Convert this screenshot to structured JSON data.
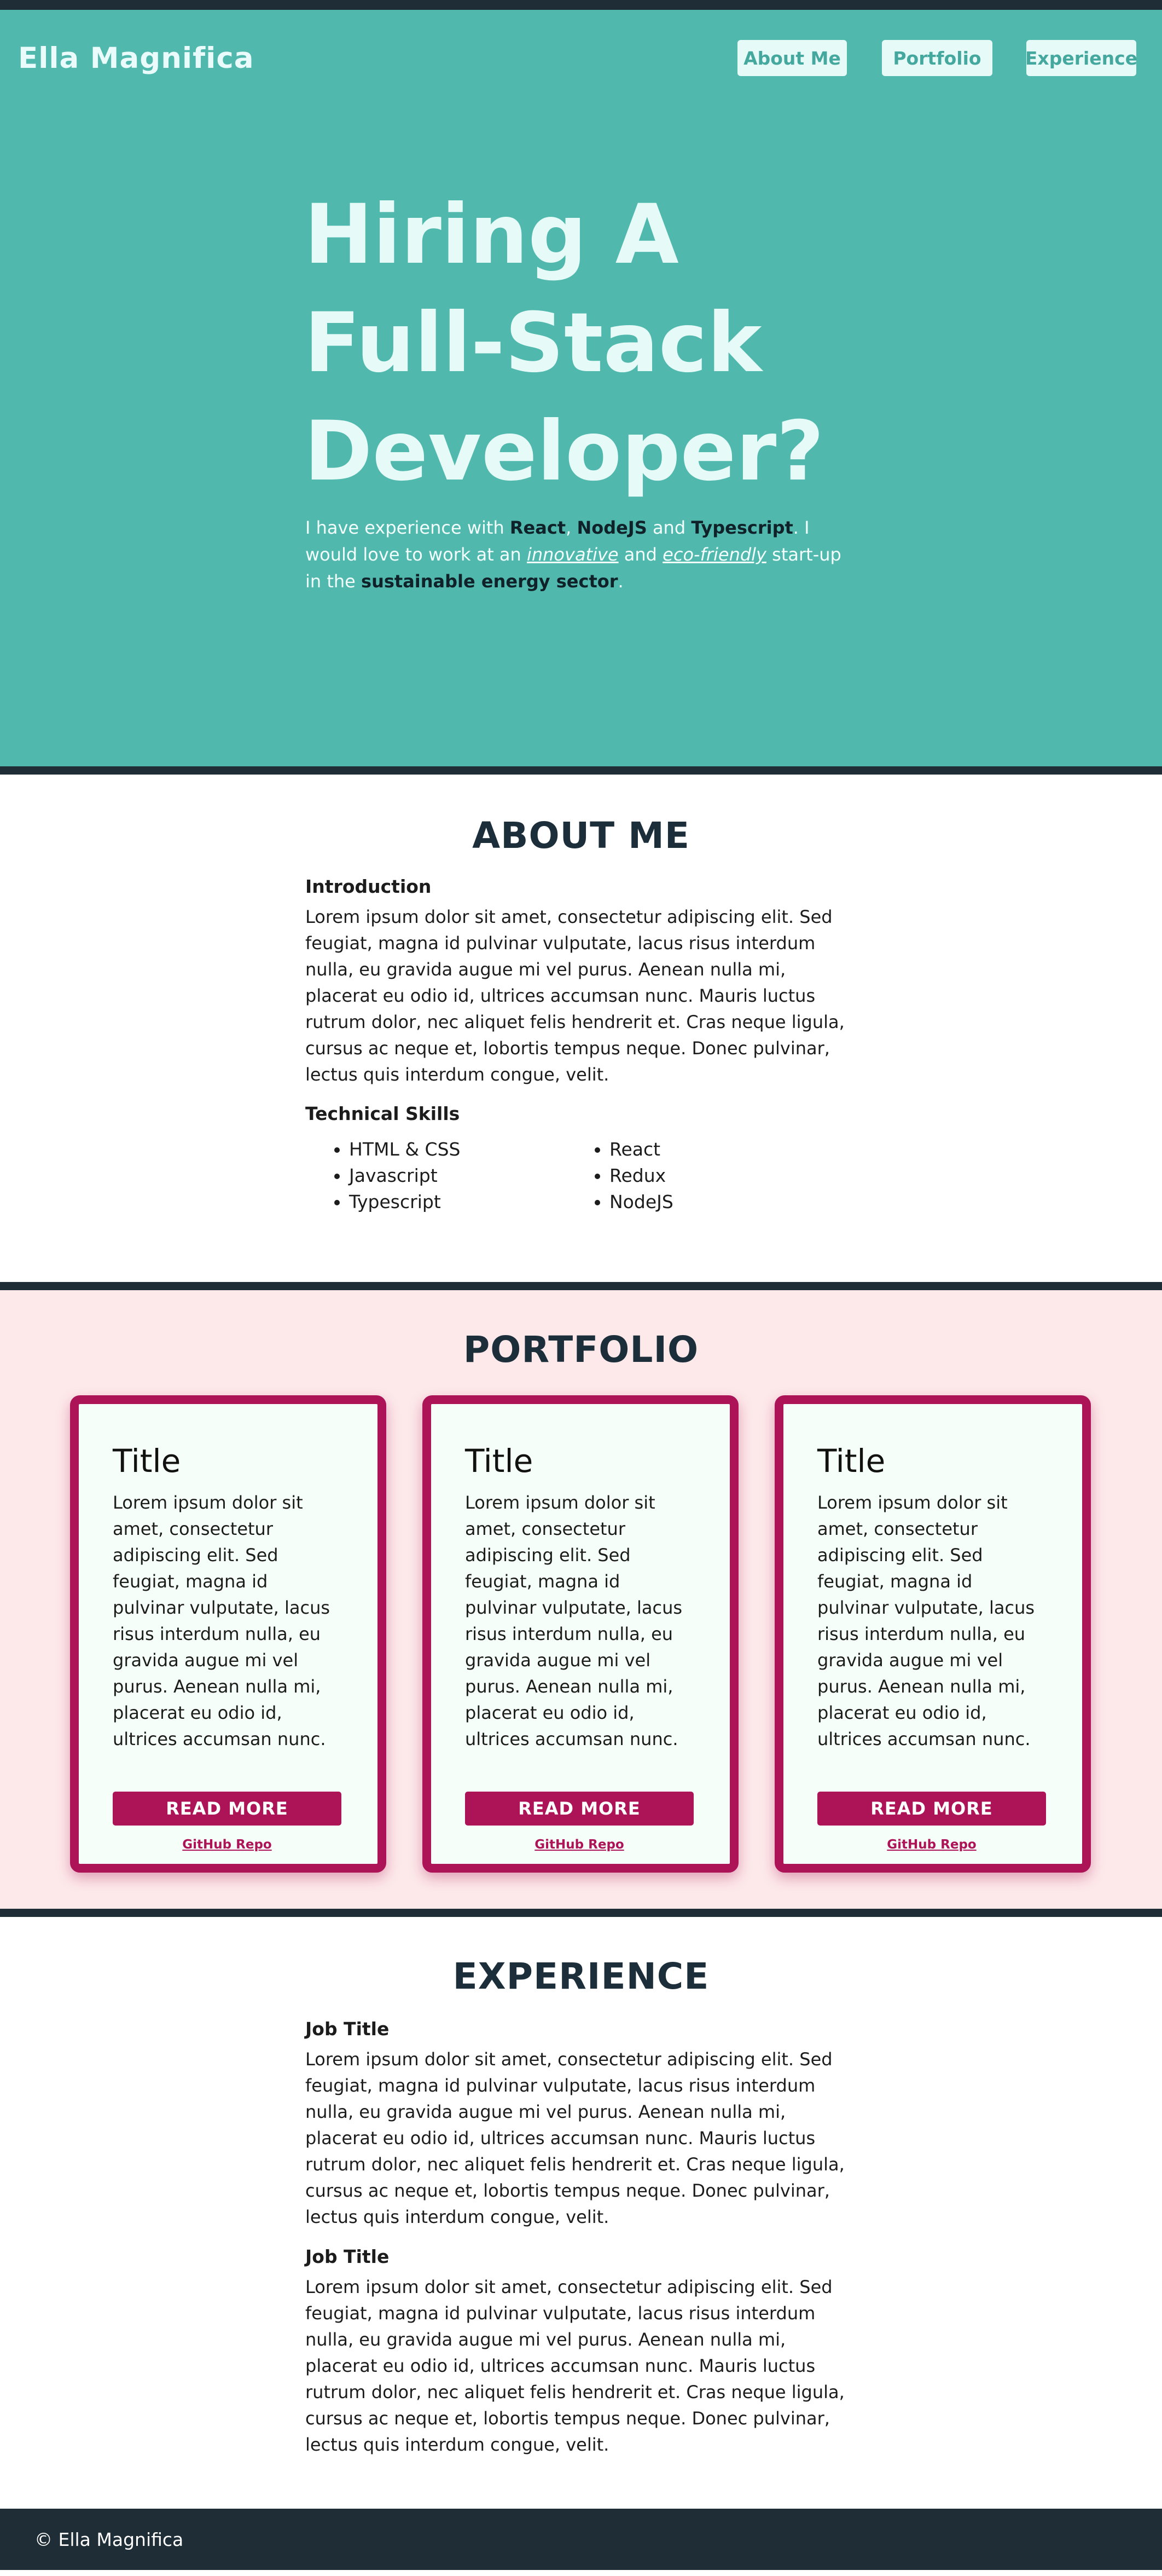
{
  "header": {
    "brand": "Ella Magnifica",
    "nav": [
      "About Me",
      "Portfolio",
      "Experience"
    ]
  },
  "hero": {
    "title_lines": [
      "Hiring A",
      "Full-Stack",
      "Developer?"
    ],
    "text": {
      "t1": "I have experience with ",
      "react": "React",
      "sep1": ", ",
      "node": "NodeJS",
      "sep2": " and ",
      "ts": "Typescript",
      "t2": ". I would love to work at an ",
      "innovative": "innovative",
      "t3": " and ",
      "eco": "eco-friendly",
      "t4": " start-up in the ",
      "sector": "sustainable energy sector",
      "t5": "."
    }
  },
  "about": {
    "title": "ABOUT ME",
    "intro_heading": "Introduction",
    "intro_text": "Lorem ipsum dolor sit amet, consectetur adipiscing elit. Sed feugiat, magna id pulvinar vulputate, lacus risus interdum nulla, eu gravida augue mi vel purus. Aenean nulla mi, placerat eu odio id, ultrices accumsan nunc. Mauris luctus rutrum dolor, nec aliquet felis hendrerit et. Cras neque ligula, cursus ac neque et, lobortis tempus neque. Donec pulvinar, lectus quis interdum congue, velit.",
    "skills_heading": "Technical Skills",
    "skills": [
      "HTML & CSS",
      "React",
      "Javascript",
      "Redux",
      "Typescript",
      "NodeJS"
    ]
  },
  "portfolio": {
    "title": "PORTFOLIO",
    "cards": [
      {
        "title": "Title",
        "text": "Lorem ipsum dolor sit amet, consectetur adipiscing elit. Sed feugiat, magna id pulvinar vulputate, lacus risus interdum nulla, eu gravida augue mi vel purus. Aenean nulla mi, placerat eu odio id, ultrices accumsan nunc.",
        "button": "READ MORE",
        "link": "GitHub Repo"
      },
      {
        "title": "Title",
        "text": "Lorem ipsum dolor sit amet, consectetur adipiscing elit. Sed feugiat, magna id pulvinar vulputate, lacus risus interdum nulla, eu gravida augue mi vel purus. Aenean nulla mi, placerat eu odio id, ultrices accumsan nunc.",
        "button": "READ MORE",
        "link": "GitHub Repo"
      },
      {
        "title": "Title",
        "text": "Lorem ipsum dolor sit amet, consectetur adipiscing elit. Sed feugiat, magna id pulvinar vulputate, lacus risus interdum nulla, eu gravida augue mi vel purus. Aenean nulla mi, placerat eu odio id, ultrices accumsan nunc.",
        "button": "READ MORE",
        "link": "GitHub Repo"
      }
    ]
  },
  "experience": {
    "title": "EXPERIENCE",
    "jobs": [
      {
        "title": "Job Title",
        "text": "Lorem ipsum dolor sit amet, consectetur adipiscing elit. Sed feugiat, magna id pulvinar vulputate, lacus risus interdum nulla, eu gravida augue mi vel purus. Aenean nulla mi, placerat eu odio id, ultrices accumsan nunc. Mauris luctus rutrum dolor, nec aliquet felis hendrerit et. Cras neque ligula, cursus ac neque et, lobortis tempus neque. Donec pulvinar, lectus quis interdum congue, velit."
      },
      {
        "title": "Job Title",
        "text": "Lorem ipsum dolor sit amet, consectetur adipiscing elit. Sed feugiat, magna id pulvinar vulputate, lacus risus interdum nulla, eu gravida augue mi vel purus. Aenean nulla mi, placerat eu odio id, ultrices accumsan nunc. Mauris luctus rutrum dolor, nec aliquet felis hendrerit et. Cras neque ligula, cursus ac neque et, lobortis tempus neque. Donec pulvinar, lectus quis interdum congue, velit."
      }
    ]
  },
  "footer": {
    "text": "© Ella Magnifica"
  },
  "colors": {
    "hero_bg": "#51b8ad",
    "dark": "#1f2d36",
    "accent": "#ad1457",
    "portfolio_bg": "#fde9ea"
  }
}
